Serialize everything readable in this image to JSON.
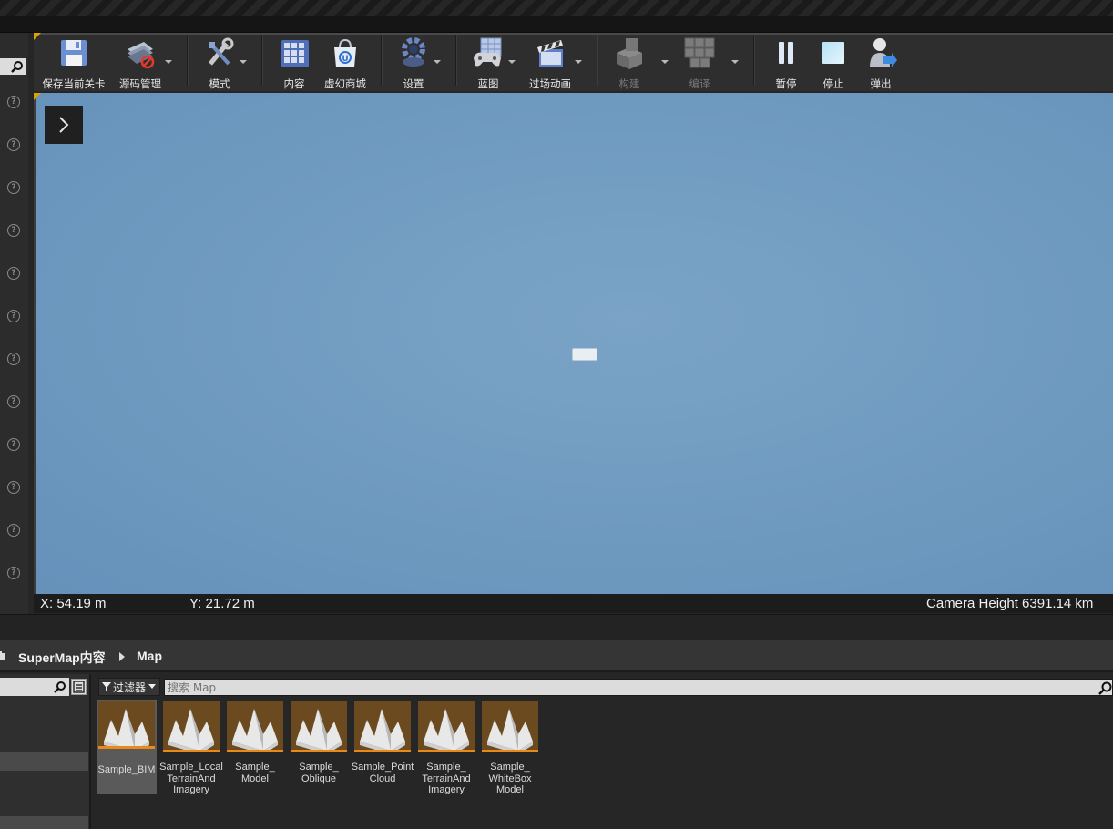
{
  "toolbar": {
    "save": "保存当前关卡",
    "source_control": "源码管理",
    "modes": "模式",
    "content": "内容",
    "marketplace": "虚幻商城",
    "settings": "设置",
    "blueprints": "蓝图",
    "cinematics": "过场动画",
    "build": "构建",
    "compile": "编译",
    "pause": "暂停",
    "stop": "停止",
    "eject": "弹出"
  },
  "viewport": {
    "x_readout": "X: 54.19 m",
    "y_readout": "Y: 21.72 m",
    "camera_height": "Camera Height  6391.14 km"
  },
  "breadcrumb": {
    "root": "SuperMap内容",
    "current": "Map"
  },
  "content_browser": {
    "filter_label": "过滤器",
    "search_placeholder": "搜索 Map",
    "assets": [
      {
        "name": "Sample_BIM"
      },
      {
        "name": "Sample_Local\nTerrainAnd\nImagery"
      },
      {
        "name": "Sample_\nModel"
      },
      {
        "name": "Sample_\nOblique"
      },
      {
        "name": "Sample_Point\nCloud"
      },
      {
        "name": "Sample_\nTerrainAnd\nImagery"
      },
      {
        "name": "Sample_\nWhiteBox\nModel"
      }
    ]
  },
  "colors": {
    "viewport_sky": "#719cc1",
    "accent_orange": "#e8891a",
    "corner_gold": "#d9a300"
  }
}
